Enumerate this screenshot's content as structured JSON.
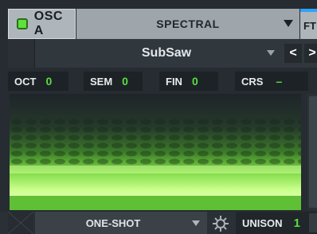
{
  "osc": {
    "label": "OSC A",
    "enabled": true,
    "enabled_color": "#5de23a"
  },
  "warp": {
    "type_label": "SPECTRAL"
  },
  "next_tab": {
    "label": "FT"
  },
  "wavetable": {
    "name": "SubSaw",
    "prev_label": "<",
    "next_label": ">"
  },
  "params": [
    {
      "label": "OCT",
      "value": "0"
    },
    {
      "label": "SEM",
      "value": "0"
    },
    {
      "label": "FIN",
      "value": "0"
    },
    {
      "label": "CRS",
      "value": "–"
    }
  ],
  "bottom": {
    "mode_label": "ONE-SHOT",
    "unison_label": "UNISON",
    "unison_value": "1"
  },
  "colors": {
    "accent_green": "#58de3f",
    "accent_blue": "#2ea3ff",
    "panel_bg": "#262c31"
  },
  "icons": {
    "settings": "gear-icon",
    "dropdown": "chevron-down-icon",
    "enable": "power-led-icon"
  }
}
